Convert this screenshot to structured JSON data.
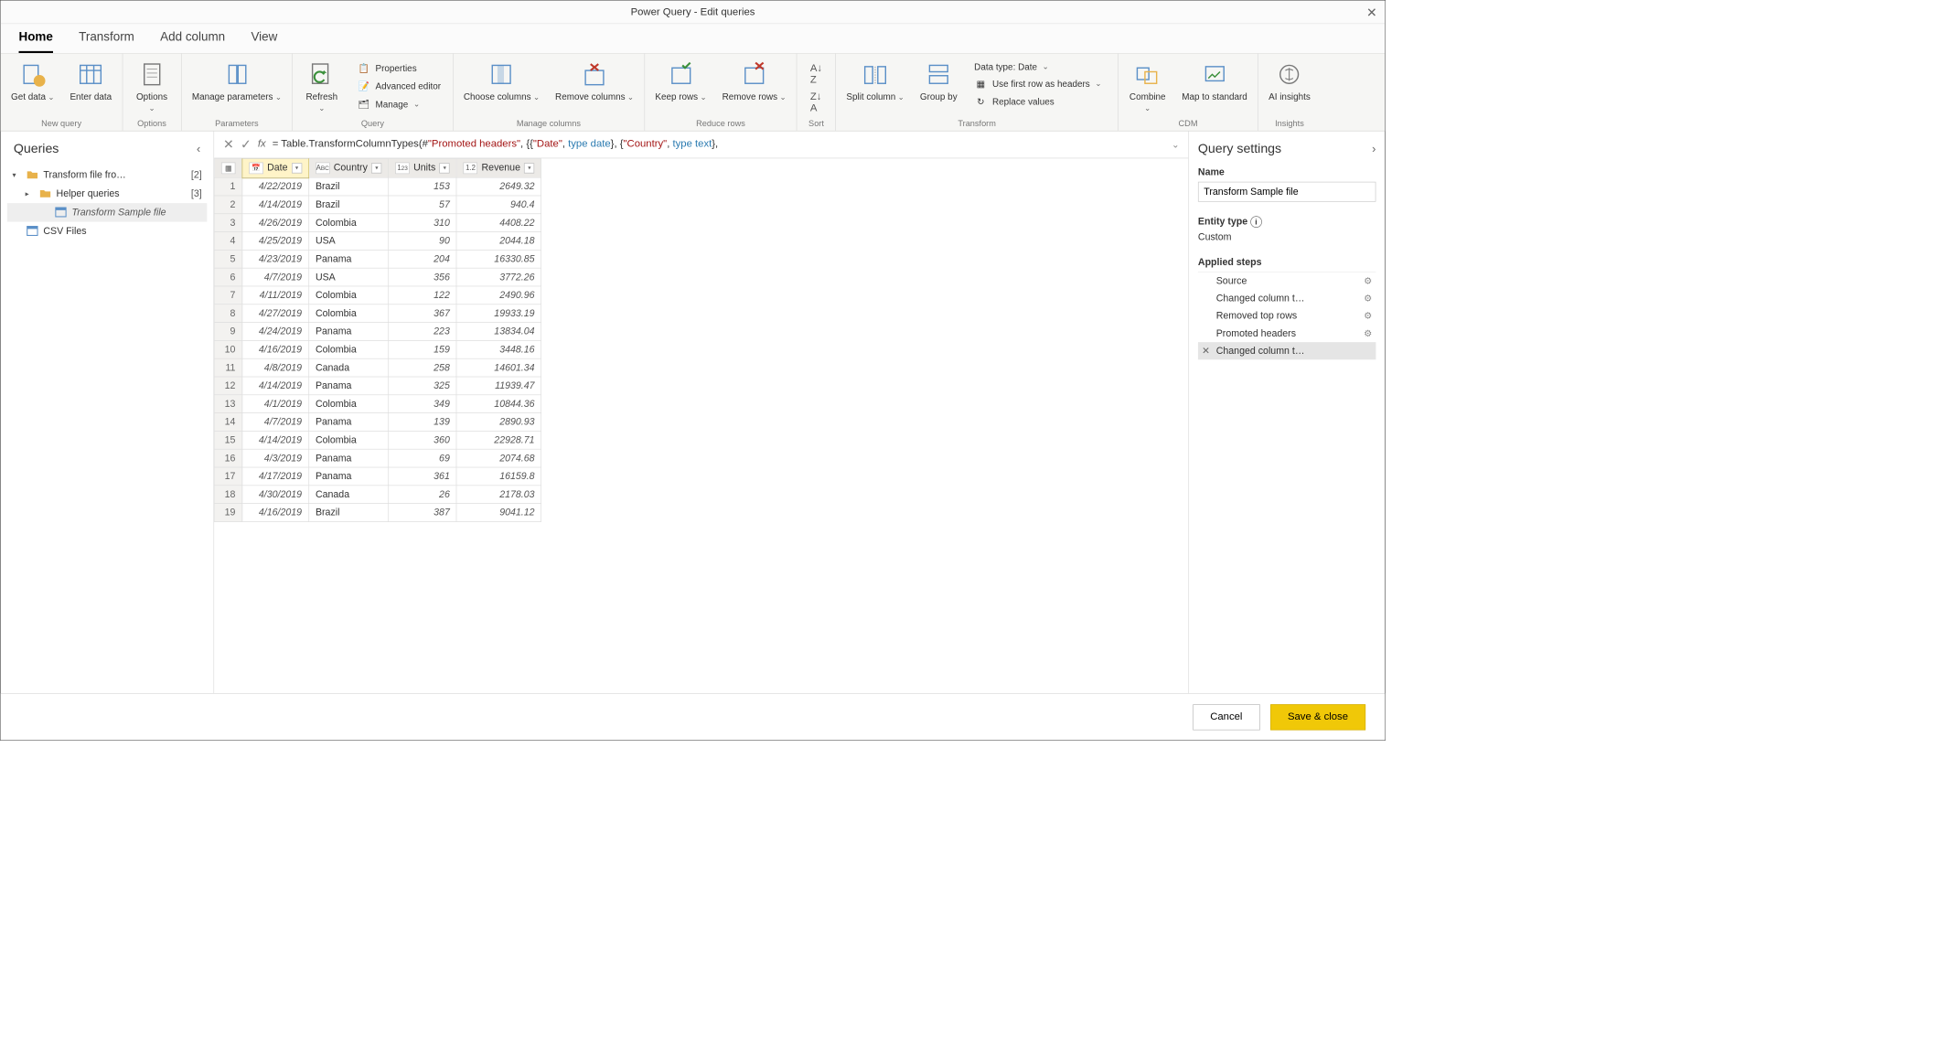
{
  "window": {
    "title": "Power Query - Edit queries"
  },
  "tabs": [
    "Home",
    "Transform",
    "Add column",
    "View"
  ],
  "ribbon": {
    "groups": [
      {
        "label": "New query",
        "buttons": [
          {
            "label": "Get data",
            "dropdown": true
          },
          {
            "label": "Enter data"
          }
        ]
      },
      {
        "label": "Options",
        "buttons": [
          {
            "label": "Options",
            "dropdown": true
          }
        ]
      },
      {
        "label": "Parameters",
        "buttons": [
          {
            "label": "Manage parameters",
            "dropdown": true
          }
        ]
      },
      {
        "label": "Query",
        "buttons": [
          {
            "label": "Refresh",
            "dropdown": true
          }
        ],
        "small_items": [
          "Properties",
          "Advanced editor",
          "Manage"
        ]
      },
      {
        "label": "Manage columns",
        "buttons": [
          {
            "label": "Choose columns",
            "dropdown": true
          },
          {
            "label": "Remove columns",
            "dropdown": true
          }
        ]
      },
      {
        "label": "Reduce rows",
        "buttons": [
          {
            "label": "Keep rows",
            "dropdown": true
          },
          {
            "label": "Remove rows",
            "dropdown": true
          }
        ]
      },
      {
        "label": "Sort",
        "buttons": []
      },
      {
        "label": "Transform",
        "buttons": [
          {
            "label": "Split column",
            "dropdown": true
          },
          {
            "label": "Group by"
          }
        ],
        "small_items": [
          "Data type: Date",
          "Use first row as headers",
          "Replace values"
        ]
      },
      {
        "label": "CDM",
        "buttons": [
          {
            "label": "Combine",
            "dropdown": true
          },
          {
            "label": "Map to standard"
          }
        ]
      },
      {
        "label": "Insights",
        "buttons": [
          {
            "label": "AI insights"
          }
        ]
      }
    ]
  },
  "left": {
    "title": "Queries",
    "items": [
      {
        "label": "Transform file fro…",
        "count": "[2]",
        "kind": "folder",
        "expanded": true
      },
      {
        "label": "Helper queries",
        "count": "[3]",
        "kind": "folder",
        "indent": 1
      },
      {
        "label": "Transform Sample file",
        "kind": "query",
        "indent": 2,
        "italic": true,
        "active": true
      },
      {
        "label": "CSV Files",
        "kind": "query",
        "indent": 0
      }
    ]
  },
  "formula": {
    "prefix": "= ",
    "fn": "Table.TransformColumnTypes(#",
    "str1": "\"Promoted headers\"",
    "mid1": ", {{",
    "str2": "\"Date\"",
    "mid2": ", ",
    "t1a": "type ",
    "t1b": "date",
    "mid3": "}, {",
    "str3": "\"Country\"",
    "mid4": ", ",
    "t2a": "type ",
    "t2b": "text",
    "end": "},"
  },
  "columns": [
    {
      "name": "Date",
      "type": "date",
      "selected": true
    },
    {
      "name": "Country",
      "type": "text"
    },
    {
      "name": "Units",
      "type": "int"
    },
    {
      "name": "Revenue",
      "type": "decimal"
    }
  ],
  "rows": [
    {
      "n": 1,
      "date": "4/22/2019",
      "country": "Brazil",
      "units": 153,
      "rev": "2649.32"
    },
    {
      "n": 2,
      "date": "4/14/2019",
      "country": "Brazil",
      "units": 57,
      "rev": "940.4"
    },
    {
      "n": 3,
      "date": "4/26/2019",
      "country": "Colombia",
      "units": 310,
      "rev": "4408.22"
    },
    {
      "n": 4,
      "date": "4/25/2019",
      "country": "USA",
      "units": 90,
      "rev": "2044.18"
    },
    {
      "n": 5,
      "date": "4/23/2019",
      "country": "Panama",
      "units": 204,
      "rev": "16330.85"
    },
    {
      "n": 6,
      "date": "4/7/2019",
      "country": "USA",
      "units": 356,
      "rev": "3772.26"
    },
    {
      "n": 7,
      "date": "4/11/2019",
      "country": "Colombia",
      "units": 122,
      "rev": "2490.96"
    },
    {
      "n": 8,
      "date": "4/27/2019",
      "country": "Colombia",
      "units": 367,
      "rev": "19933.19"
    },
    {
      "n": 9,
      "date": "4/24/2019",
      "country": "Panama",
      "units": 223,
      "rev": "13834.04"
    },
    {
      "n": 10,
      "date": "4/16/2019",
      "country": "Colombia",
      "units": 159,
      "rev": "3448.16"
    },
    {
      "n": 11,
      "date": "4/8/2019",
      "country": "Canada",
      "units": 258,
      "rev": "14601.34"
    },
    {
      "n": 12,
      "date": "4/14/2019",
      "country": "Panama",
      "units": 325,
      "rev": "11939.47"
    },
    {
      "n": 13,
      "date": "4/1/2019",
      "country": "Colombia",
      "units": 349,
      "rev": "10844.36"
    },
    {
      "n": 14,
      "date": "4/7/2019",
      "country": "Panama",
      "units": 139,
      "rev": "2890.93"
    },
    {
      "n": 15,
      "date": "4/14/2019",
      "country": "Colombia",
      "units": 360,
      "rev": "22928.71"
    },
    {
      "n": 16,
      "date": "4/3/2019",
      "country": "Panama",
      "units": 69,
      "rev": "2074.68"
    },
    {
      "n": 17,
      "date": "4/17/2019",
      "country": "Panama",
      "units": 361,
      "rev": "16159.8"
    },
    {
      "n": 18,
      "date": "4/30/2019",
      "country": "Canada",
      "units": 26,
      "rev": "2178.03"
    },
    {
      "n": 19,
      "date": "4/16/2019",
      "country": "Brazil",
      "units": 387,
      "rev": "9041.12"
    }
  ],
  "right": {
    "title": "Query settings",
    "name_label": "Name",
    "name_value": "Transform Sample file",
    "entity_label": "Entity type",
    "entity_value": "Custom",
    "steps_label": "Applied steps",
    "steps": [
      {
        "label": "Source",
        "gear": true
      },
      {
        "label": "Changed column t…",
        "gear": true
      },
      {
        "label": "Removed top rows",
        "gear": true
      },
      {
        "label": "Promoted headers",
        "gear": true
      },
      {
        "label": "Changed column t…",
        "active": true
      }
    ]
  },
  "footer": {
    "cancel": "Cancel",
    "save": "Save & close"
  }
}
